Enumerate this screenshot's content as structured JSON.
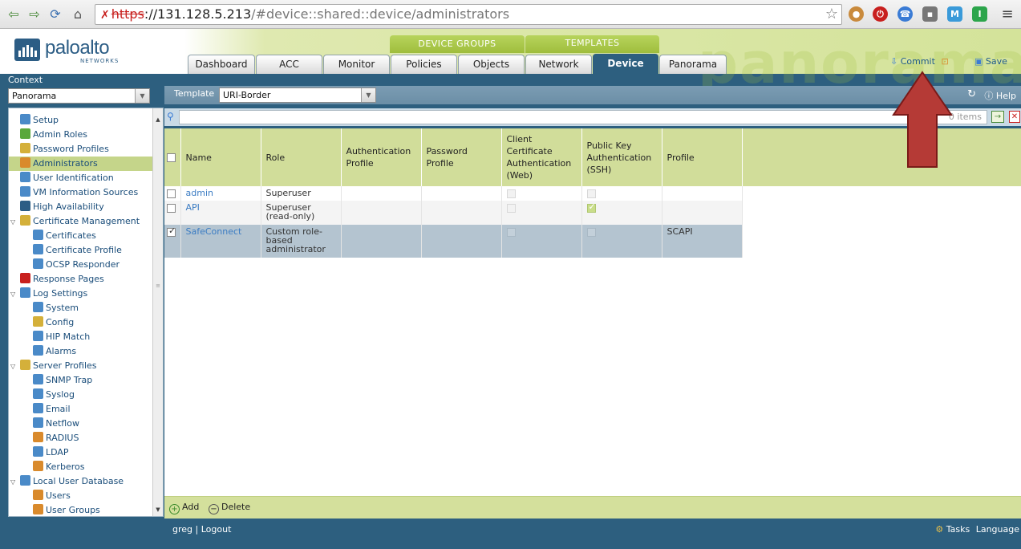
{
  "browser": {
    "url_protocol": "https",
    "url_host": "://131.128.5.213",
    "url_path": "/#device::shared::device/administrators"
  },
  "logo": {
    "text": "paloalto",
    "sub": "NETWORKS"
  },
  "watermark": "panorama",
  "groups": {
    "device_groups": "DEVICE GROUPS",
    "templates": "TEMPLATES"
  },
  "tabs": [
    "Dashboard",
    "ACC",
    "Monitor",
    "Policies",
    "Objects",
    "Network",
    "Device",
    "Panorama"
  ],
  "active_tab": "Device",
  "header_actions": {
    "commit": "Commit",
    "save": "Save"
  },
  "context": {
    "label": "Context",
    "value": "Panorama"
  },
  "nav": [
    {
      "label": "Setup",
      "level": 0,
      "color": "#4a8ac8"
    },
    {
      "label": "Admin Roles",
      "level": 0,
      "color": "#5aa83c"
    },
    {
      "label": "Password Profiles",
      "level": 0,
      "color": "#d4b03a"
    },
    {
      "label": "Administrators",
      "level": 0,
      "color": "#d98a2c",
      "selected": true
    },
    {
      "label": "User Identification",
      "level": 0,
      "color": "#4a8ac8"
    },
    {
      "label": "VM Information Sources",
      "level": 0,
      "color": "#4a8ac8"
    },
    {
      "label": "High Availability",
      "level": 0,
      "color": "#2c5d85"
    },
    {
      "label": "Certificate Management",
      "level": 0,
      "color": "#d4b03a",
      "expand": true
    },
    {
      "label": "Certificates",
      "level": 1,
      "color": "#4a8ac8"
    },
    {
      "label": "Certificate Profile",
      "level": 1,
      "color": "#4a8ac8"
    },
    {
      "label": "OCSP Responder",
      "level": 1,
      "color": "#4a8ac8"
    },
    {
      "label": "Response Pages",
      "level": 0,
      "color": "#c8201e"
    },
    {
      "label": "Log Settings",
      "level": 0,
      "color": "#4a8ac8",
      "expand": true
    },
    {
      "label": "System",
      "level": 1,
      "color": "#4a8ac8"
    },
    {
      "label": "Config",
      "level": 1,
      "color": "#d4b03a"
    },
    {
      "label": "HIP Match",
      "level": 1,
      "color": "#4a8ac8"
    },
    {
      "label": "Alarms",
      "level": 1,
      "color": "#4a8ac8"
    },
    {
      "label": "Server Profiles",
      "level": 0,
      "color": "#d4b03a",
      "expand": true
    },
    {
      "label": "SNMP Trap",
      "level": 1,
      "color": "#4a8ac8"
    },
    {
      "label": "Syslog",
      "level": 1,
      "color": "#4a8ac8"
    },
    {
      "label": "Email",
      "level": 1,
      "color": "#4a8ac8"
    },
    {
      "label": "Netflow",
      "level": 1,
      "color": "#4a8ac8"
    },
    {
      "label": "RADIUS",
      "level": 1,
      "color": "#d98a2c"
    },
    {
      "label": "LDAP",
      "level": 1,
      "color": "#4a8ac8"
    },
    {
      "label": "Kerberos",
      "level": 1,
      "color": "#d98a2c"
    },
    {
      "label": "Local User Database",
      "level": 0,
      "color": "#4a8ac8",
      "expand": true
    },
    {
      "label": "Users",
      "level": 1,
      "color": "#d98a2c"
    },
    {
      "label": "User Groups",
      "level": 1,
      "color": "#d98a2c"
    }
  ],
  "template": {
    "label": "Template",
    "value": "URI-Border"
  },
  "help": "Help",
  "filter": {
    "items_text": "0 items"
  },
  "table": {
    "columns": [
      "Name",
      "Role",
      "Authentication Profile",
      "Password Profile",
      "Client Certificate Authentication (Web)",
      "Public Key Authentication (SSH)",
      "Profile"
    ],
    "rows": [
      {
        "checked": false,
        "name": "admin",
        "role": "Superuser",
        "auth_profile": "",
        "password_profile": "",
        "client_cert": false,
        "public_key": false,
        "profile": ""
      },
      {
        "checked": false,
        "name": "API",
        "role": "Superuser (read-only)",
        "auth_profile": "",
        "password_profile": "",
        "client_cert": false,
        "public_key": true,
        "profile": ""
      },
      {
        "checked": true,
        "name": "SafeConnect",
        "role": "Custom role-based administrator",
        "auth_profile": "",
        "password_profile": "",
        "client_cert": false,
        "public_key": false,
        "profile": "SCAPI"
      }
    ]
  },
  "actions": {
    "add": "Add",
    "delete": "Delete"
  },
  "status": {
    "user": "greg",
    "logout": "Logout",
    "tasks": "Tasks",
    "language": "Language"
  },
  "annotation_color": "#b53a36"
}
